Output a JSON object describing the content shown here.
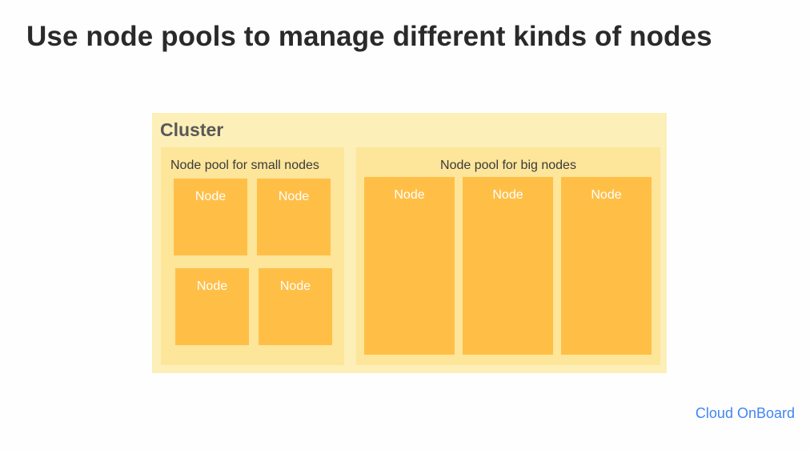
{
  "title": "Use node pools to manage different kinds of nodes",
  "cluster": {
    "label": "Cluster",
    "small_pool": {
      "label": "Node pool for small nodes",
      "nodes": [
        "Node",
        "Node",
        "Node",
        "Node"
      ]
    },
    "big_pool": {
      "label": "Node pool for big nodes",
      "nodes": [
        "Node",
        "Node",
        "Node"
      ]
    }
  },
  "footer": {
    "brand": "Cloud OnBoard"
  },
  "colors": {
    "title_text": "#2a2a2a",
    "cluster_bg": "#fcefb8",
    "cluster_label": "#595959",
    "pool_bg": "#fde59a",
    "pool_label": "#3a3a3a",
    "node_bg": "#ffbf47",
    "node_label": "#ffffff",
    "brand": "#4285f4"
  }
}
